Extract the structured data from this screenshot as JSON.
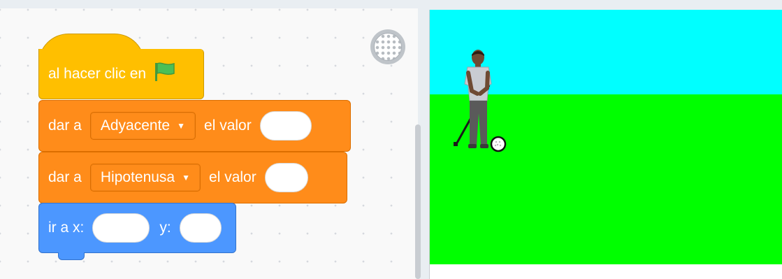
{
  "code_area": {
    "hat_block": {
      "label": "al hacer clic en",
      "icon": "green-flag-icon"
    },
    "set_block_1": {
      "prefix": "dar a",
      "variable": "Adyacente",
      "suffix": "el valor",
      "value": ""
    },
    "set_block_2": {
      "prefix": "dar a",
      "variable": "Hipotenusa",
      "suffix": "el valor",
      "value": ""
    },
    "goto_block": {
      "prefix": "ir a x:",
      "x_value": "",
      "y_label": "y:",
      "y_value": ""
    }
  },
  "stage": {
    "sky_color": "#00ffff",
    "grass_color": "#00ff00",
    "sprites": [
      "golfer-sprite",
      "golf-ball-sprite"
    ]
  },
  "colors": {
    "events": "#ffbf00",
    "variables": "#ff8c1a",
    "motion": "#4c97ff"
  }
}
